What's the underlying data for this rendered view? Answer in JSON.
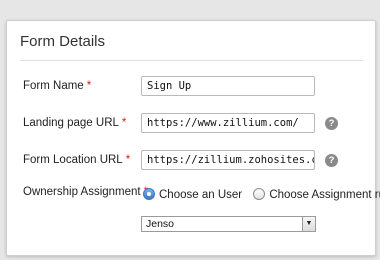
{
  "panel": {
    "title": "Form Details"
  },
  "fields": {
    "form_name": {
      "label": "Form Name",
      "required_mark": "*",
      "value": "Sign Up"
    },
    "landing_page_url": {
      "label": "Landing page URL",
      "required_mark": "*",
      "value": "https://www.zillium.com/",
      "help_icon": "question-circle"
    },
    "form_location_url": {
      "label": "Form Location URL",
      "required_mark": "*",
      "value": "https://zillium.zohosites.com/",
      "help_icon": "question-circle"
    },
    "ownership_assignment": {
      "label": "Ownership Assignment",
      "required_mark": "*",
      "options": [
        {
          "label": "Choose an User",
          "checked": true
        },
        {
          "label": "Choose Assignment rule",
          "checked": false
        }
      ],
      "selected_user": "Jenso"
    }
  },
  "help_glyph": "?",
  "dropdown_glyph": "▼",
  "colors": {
    "required": "#d42020",
    "radio_selected": "#3b78c4",
    "help_icon": "#8a8a8a"
  }
}
